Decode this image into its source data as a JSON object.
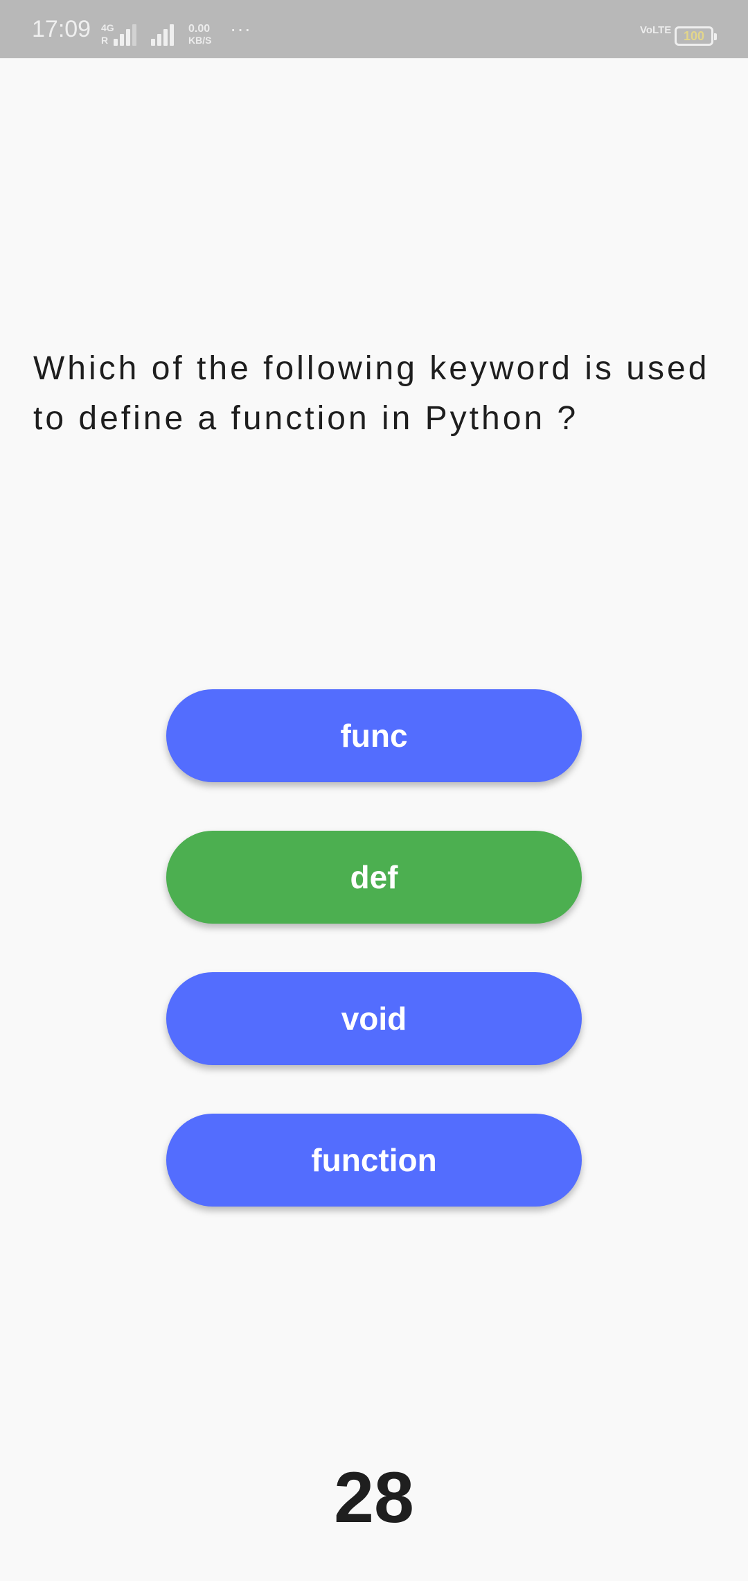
{
  "status_bar": {
    "time": "17:09",
    "network_type": "4G",
    "roaming": "R",
    "net_speed_value": "0.00",
    "net_speed_unit": "KB/S",
    "more": "···",
    "volte": "VoLTE",
    "battery_level": "100",
    "icons": [
      "signal-1-icon",
      "signal-2-icon",
      "battery-icon"
    ]
  },
  "quiz": {
    "question": "Which of the following keyword is used to define a function in Python ?",
    "answers": [
      {
        "label": "func",
        "color": "#536dfe"
      },
      {
        "label": "def",
        "color": "#4caf50"
      },
      {
        "label": "void",
        "color": "#536dfe"
      },
      {
        "label": "function",
        "color": "#536dfe"
      }
    ],
    "timer": "28"
  },
  "colors": {
    "answer_default": "#536dfe",
    "answer_correct": "#4caf50",
    "background": "#f9f9f9",
    "status_bar": "#b8b8b8"
  }
}
